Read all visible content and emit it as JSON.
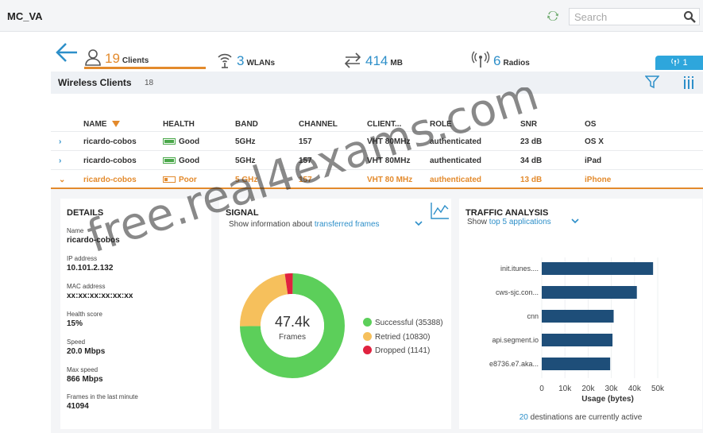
{
  "app": {
    "title": "MC_VA"
  },
  "search": {
    "placeholder": "Search"
  },
  "summary": {
    "clients": {
      "count": "19",
      "label": "Clients"
    },
    "wlans": {
      "count": "3",
      "label": "WLANs"
    },
    "throughput": {
      "count": "414",
      "label": "MB"
    },
    "radios": {
      "count": "6",
      "label": "Radios"
    },
    "badge": "1"
  },
  "wireless_clients": {
    "title": "Wireless Clients",
    "count": "18",
    "columns": [
      "NAME",
      "HEALTH",
      "BAND",
      "CHANNEL",
      "CLIENT...",
      "ROLE",
      "SNR",
      "OS"
    ],
    "rows": [
      {
        "expander": "›",
        "name": "ricardo-cobos",
        "health": "Good",
        "band": "5GHz",
        "channel": "157",
        "client": "VHT 80MHz",
        "role": "authenticated",
        "snr": "23 dB",
        "os": "OS X"
      },
      {
        "expander": "›",
        "name": "ricardo-cobos",
        "health": "Good",
        "band": "5GHz",
        "channel": "157",
        "client": "VHT 80MHz",
        "role": "authenticated",
        "snr": "34 dB",
        "os": "iPad"
      },
      {
        "expander": "⌄",
        "name": "ricardo-cobos",
        "health": "Poor",
        "band": "5 GHz",
        "channel": "157",
        "client": "VHT 80 MHz",
        "role": "authenticated",
        "snr": "13 dB",
        "os": "iPhone"
      }
    ],
    "health_levels": [
      1.0,
      1.0,
      0.3
    ]
  },
  "details": {
    "title": "DETAILS",
    "fields": [
      {
        "label": "Name",
        "value": "ricardo-cobos"
      },
      {
        "label": "IP address",
        "value": "10.101.2.132"
      },
      {
        "label": "MAC address",
        "value": "xx:xx:xx:xx:xx:xx"
      },
      {
        "label": "Health score",
        "value": "15%"
      },
      {
        "label": "Speed",
        "value": "20.0 Mbps"
      },
      {
        "label": "Max speed",
        "value": "866 Mbps"
      },
      {
        "label": "Frames in the last minute",
        "value": "41094"
      }
    ]
  },
  "signal": {
    "title": "SIGNAL",
    "subtitle_prefix": "Show information about",
    "subtitle_link": "transferred frames",
    "center_value": "47.4k",
    "center_label": "Frames",
    "legend": [
      {
        "label": "Successful (35388)"
      },
      {
        "label": "Retried (10830)"
      },
      {
        "label": "Dropped (1141)"
      }
    ]
  },
  "traffic": {
    "title": "TRAFFIC ANALYSIS",
    "subtitle_prefix": "Show",
    "subtitle_link": "top 5 applications",
    "footer_count": "20",
    "footer_text": "destinations are currently active"
  },
  "colors": {
    "accent": "#e38a2c",
    "link": "#2d8fc9",
    "success": "#5ccf5a",
    "retried": "#f6c05c",
    "dropped": "#e0223f",
    "bar": "#1e4e79"
  },
  "chart_data": [
    {
      "type": "pie",
      "categories": [
        "Successful",
        "Retried",
        "Dropped"
      ],
      "values": [
        35388,
        10830,
        1141
      ],
      "colors": [
        "#5ccf5a",
        "#f6c05c",
        "#e0223f"
      ]
    },
    {
      "type": "bar",
      "orientation": "horizontal",
      "categories": [
        "init.itunes....",
        "cws-sjc.con...",
        "cnn",
        "api.segment.io",
        "e8736.e7.aka..."
      ],
      "values": [
        48000,
        41000,
        31000,
        30500,
        29500
      ],
      "xlabel": "Usage (bytes)",
      "xticks": [
        "0",
        "10k",
        "20k",
        "30k",
        "40k",
        "50k"
      ],
      "xlim": [
        0,
        50000
      ]
    }
  ]
}
